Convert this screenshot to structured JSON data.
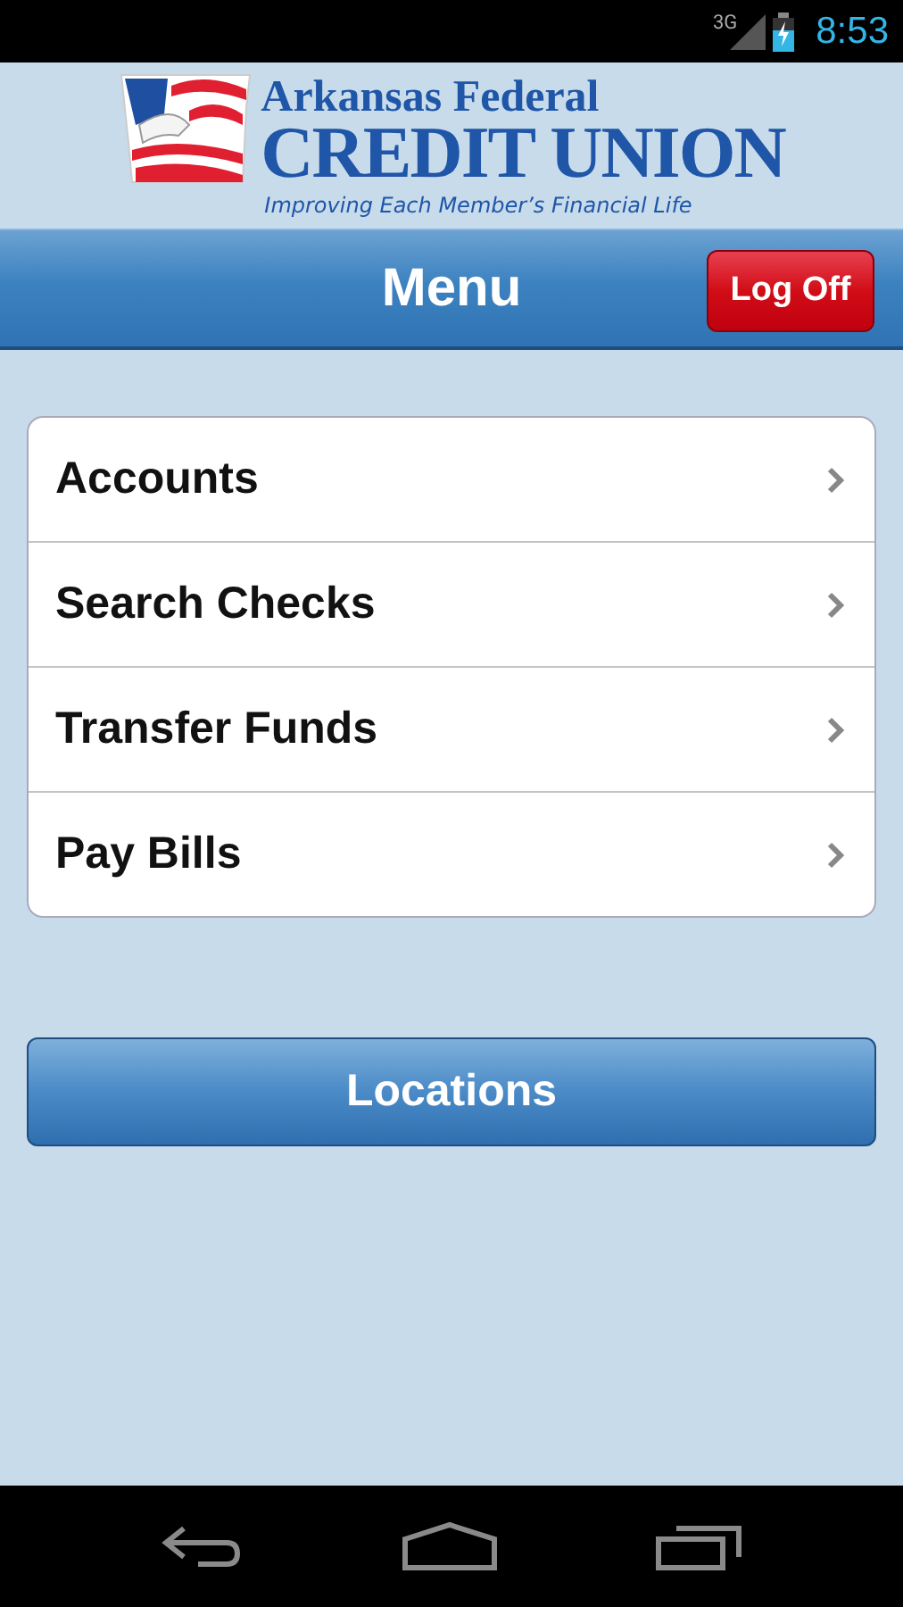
{
  "status_bar": {
    "network": "3G",
    "time": "8:53"
  },
  "logo": {
    "line_1": "Arkansas Federal",
    "line_2": "CREDIT UNION",
    "tagline": "Improving Each Member’s Financial Life"
  },
  "header": {
    "title": "Menu",
    "button": "Log Off"
  },
  "menu_items": [
    {
      "label": "Accounts"
    },
    {
      "label": "Search Checks"
    },
    {
      "label": "Transfer Funds"
    },
    {
      "label": "Pay Bills"
    }
  ],
  "locations_button": "Locations"
}
